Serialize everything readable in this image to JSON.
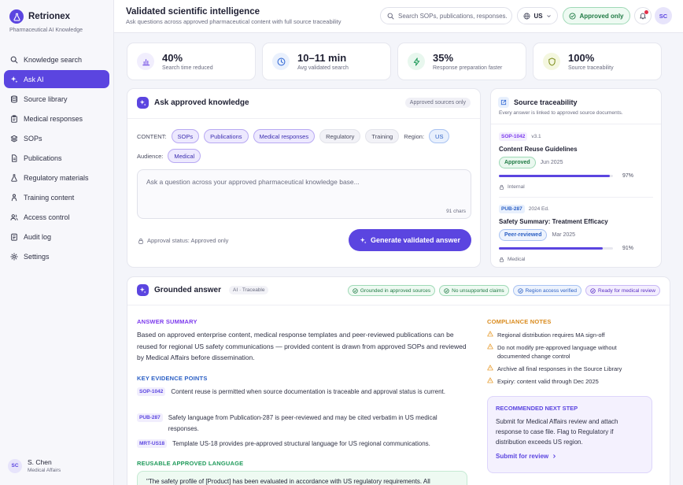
{
  "app": {
    "name": "Retrionex",
    "tagline": "Pharmaceutical AI Knowledge"
  },
  "nav": [
    {
      "label": "Knowledge search",
      "icon": "search-icon"
    },
    {
      "label": "Ask AI",
      "icon": "sparkle-icon",
      "active": true
    },
    {
      "label": "Source library",
      "icon": "database-icon"
    },
    {
      "label": "Medical responses",
      "icon": "clipboard-icon"
    },
    {
      "label": "SOPs",
      "icon": "layers-icon"
    },
    {
      "label": "Publications",
      "icon": "document-icon"
    },
    {
      "label": "Regulatory materials",
      "icon": "flask-icon"
    },
    {
      "label": "Training content",
      "icon": "training-icon"
    },
    {
      "label": "Access control",
      "icon": "users-icon"
    },
    {
      "label": "Audit log",
      "icon": "log-icon"
    },
    {
      "label": "Settings",
      "icon": "gear-icon"
    }
  ],
  "user": {
    "initials": "SC",
    "name": "S. Chen",
    "role": "Medical Affairs"
  },
  "header": {
    "title": "Validated scientific intelligence",
    "subtitle": "Ask questions across approved pharmaceutical content with full source traceability",
    "search_placeholder": "Search SOPs, publications, responses...",
    "region": "US",
    "approved_toggle": "Approved only",
    "avatar": "SC"
  },
  "kpis": [
    {
      "value": "40%",
      "label": "Search time reduced",
      "color": "#7c5ae6",
      "bg": "#f1eefd"
    },
    {
      "value": "10–11 min",
      "label": "Avg validated search",
      "color": "#3b6fd6",
      "bg": "#eaf1fd"
    },
    {
      "value": "35%",
      "label": "Response preparation faster",
      "color": "#1f9a5a",
      "bg": "#e8f7ee"
    },
    {
      "value": "100%",
      "label": "Source traceability",
      "color": "#7a8a16",
      "bg": "#f4f7df"
    }
  ],
  "ask": {
    "title": "Ask approved knowledge",
    "badge": "Approved sources only",
    "content_label": "CONTENT:",
    "content_chips": [
      {
        "label": "SOPs",
        "selected": true
      },
      {
        "label": "Publications",
        "selected": true
      },
      {
        "label": "Medical responses",
        "selected": true
      },
      {
        "label": "Regulatory",
        "selected": false
      },
      {
        "label": "Training",
        "selected": false
      }
    ],
    "region_label": "Region:",
    "region_chip": "US",
    "audience_label": "Audience:",
    "audience_chip": "Medical",
    "placeholder": "Ask a question across your approved pharmaceutical knowledge base...",
    "char_count": "91 chars",
    "approval_status": "Approval status: Approved only",
    "button": "Generate validated answer"
  },
  "sources": {
    "title": "Source traceability",
    "subtitle": "Every answer is linked to approved source documents.",
    "items": [
      {
        "code": "SOP-1042",
        "version": "v3.1",
        "name": "Content Reuse Guidelines",
        "status": "Approved",
        "date": "Jun 2025",
        "score": 97,
        "score_label": "97%",
        "scope": "Internal",
        "code_color": "#7c3aed",
        "code_bg": "#f3eefe",
        "status_color": "#1f7a44",
        "status_bg": "#eaf8ef",
        "status_border": "#9fd9b6"
      },
      {
        "code": "PUB-287",
        "version": "2024 Ed.",
        "name": "Safety Summary: Treatment Efficacy",
        "status": "Peer-reviewed",
        "date": "Mar 2025",
        "score": 91,
        "score_label": "91%",
        "scope": "Medical",
        "code_color": "#2b5fc4",
        "code_bg": "#e8f0fd",
        "status_color": "#2b5fc4",
        "status_bg": "#edf3fd",
        "status_border": "#a9c3f2"
      }
    ]
  },
  "answer": {
    "title": "Grounded answer",
    "tag": "AI · Traceable",
    "badges": [
      {
        "label": "Grounded in approved sources",
        "color": "#1f7a44",
        "bg": "#eefaf2",
        "border": "#9fd9b6"
      },
      {
        "label": "No unsupported claims",
        "color": "#1f7a44",
        "bg": "#eefaf2",
        "border": "#9fd9b6"
      },
      {
        "label": "Region access verified",
        "color": "#2b5fc4",
        "bg": "#edf3fd",
        "border": "#a9c3f2"
      },
      {
        "label": "Ready for medical review",
        "color": "#5b2fc4",
        "bg": "#f3eefe",
        "border": "#c8b8f5"
      }
    ],
    "summary_heading": "ANSWER SUMMARY",
    "summary": "Based on approved enterprise content, medical response templates and peer-reviewed publications can be reused for regional US safety communications — provided content is drawn from approved SOPs and reviewed by Medical Affairs before dissemination.",
    "evidence_heading": "KEY EVIDENCE POINTS",
    "evidence": [
      {
        "code": "SOP-1042",
        "text": "Content reuse is permitted when source documentation is traceable and approval status is current."
      },
      {
        "code": "PUB-287",
        "text": "Safety language from Publication-287 is peer-reviewed and may be cited verbatim in US medical responses."
      },
      {
        "code": "MRT-US18",
        "text": "Template US-18 provides pre-approved structural language for US regional communications."
      }
    ],
    "reusable_heading": "REUSABLE APPROVED LANGUAGE",
    "reusable_quote": "\"The safety profile of [Product] has been evaluated in accordance with US regulatory requirements. All",
    "compliance_heading": "COMPLIANCE NOTES",
    "compliance": [
      "Regional distribution requires MA sign-off",
      "Do not modify pre-approved language without documented change control",
      "Archive all final responses in the Source Library",
      "Expiry: content valid through Dec 2025"
    ],
    "next_heading": "RECOMMENDED NEXT STEP",
    "next_text": "Submit for Medical Affairs review and attach response to case file. Flag to Regulatory if distribution exceeds US region.",
    "next_link": "Submit for review"
  },
  "colors": {
    "accent": "#5b45e0",
    "warning": "#e9a23b"
  }
}
